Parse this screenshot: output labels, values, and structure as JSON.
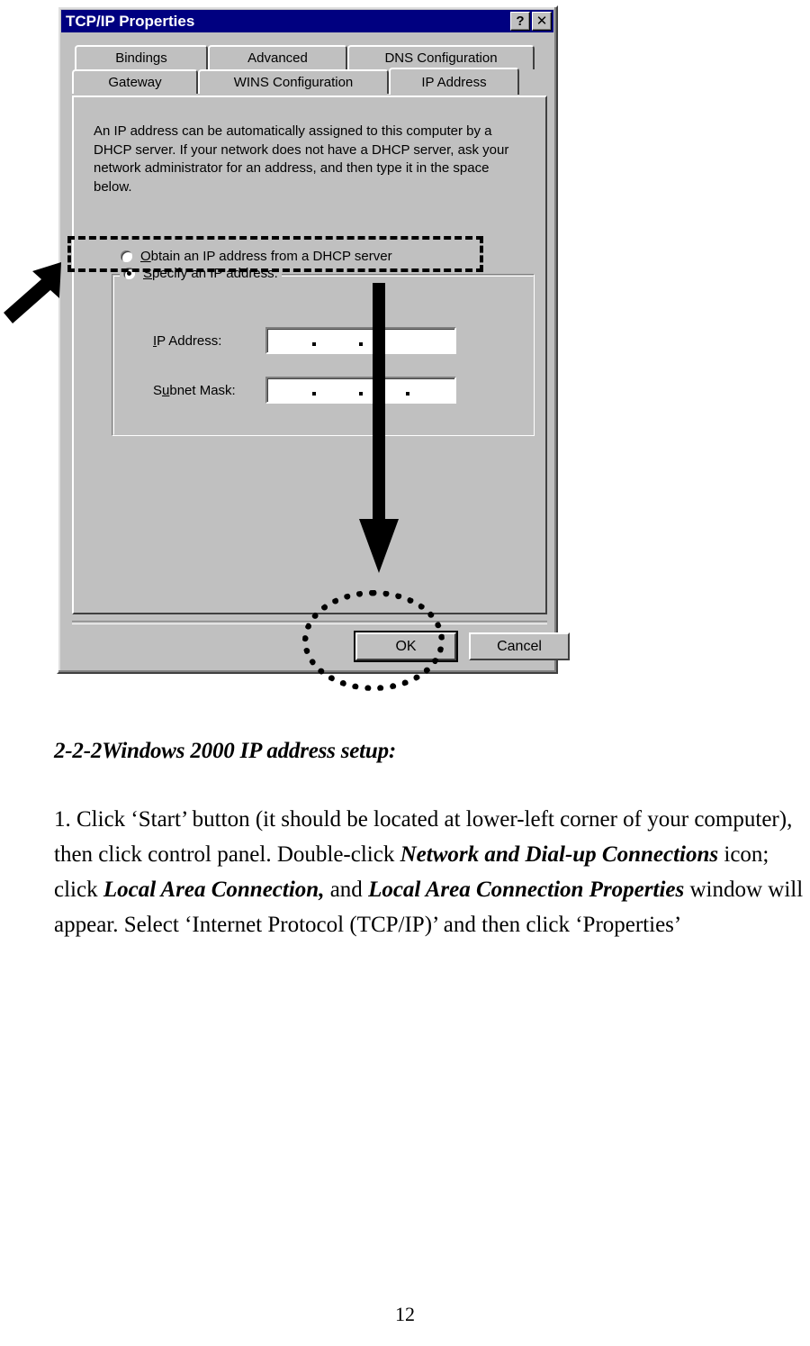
{
  "figure": {
    "dialog": {
      "title": "TCP/IP Properties",
      "titlebar_help_icon": "?",
      "titlebar_close_icon": "✕",
      "tabs_row1": [
        {
          "label": "Bindings",
          "active": false
        },
        {
          "label": "Advanced",
          "active": false
        },
        {
          "label": "DNS Configuration",
          "active": false
        }
      ],
      "tabs_row2": [
        {
          "label": "Gateway",
          "active": false
        },
        {
          "label": "WINS Configuration",
          "active": false
        },
        {
          "label": "IP Address",
          "active": true
        }
      ],
      "description": "An IP address can be automatically assigned to this computer by a DHCP server. If your network does not have a DHCP server, ask your network administrator for an address, and then type it in the space below.",
      "option_dhcp": {
        "label_prefix": "O",
        "label_rest": "btain an IP address from a DHCP server",
        "selected": false
      },
      "option_specify": {
        "label_prefix": "S",
        "label_rest": "pecify an IP address:",
        "selected": true
      },
      "fields": [
        {
          "label_prefix": "I",
          "label_rest": "P Address:",
          "value": "",
          "dots_visible": 2
        },
        {
          "label_prefix": "S",
          "label_mid": "u",
          "label_rest": "bnet Mask:",
          "value": "",
          "dots_visible": 3
        }
      ],
      "ip_label_a": "I",
      "ip_label_b": "P Address:",
      "subnet_label_a": "S",
      "subnet_label_b": "u",
      "subnet_label_c": "bnet Mask:",
      "buttons": {
        "ok": "OK",
        "cancel": "Cancel"
      }
    },
    "annotations": {
      "highlight_dhcp_option": "dashed-rectangle",
      "highlight_ok_button": "dotted-ellipse",
      "arrow_down": "thick-down-arrow",
      "arrow_pointer": "thick-up-right-arrow"
    },
    "colors": {
      "titlebar": "#000080",
      "dialog_face": "#c0c0c0",
      "field_background": "#ffffff",
      "annotation": "#000000"
    }
  },
  "document": {
    "heading": "2-2-2Windows 2000 IP address setup:",
    "paragraph": {
      "part1": "1. Click ‘Start’ button (it should be located at lower-left corner of your computer), then click control panel. Double-click ",
      "bold1": "Network and Dial-up Connections",
      "part2": " icon; click ",
      "bold2": "Local Area Connection,",
      "part3": " and ",
      "bold3": "Local Area Connection Properties",
      "part4": " window will appear. Select ‘Internet Protocol (TCP/IP)’ and then click ‘Properties’"
    },
    "page_number": "12"
  }
}
